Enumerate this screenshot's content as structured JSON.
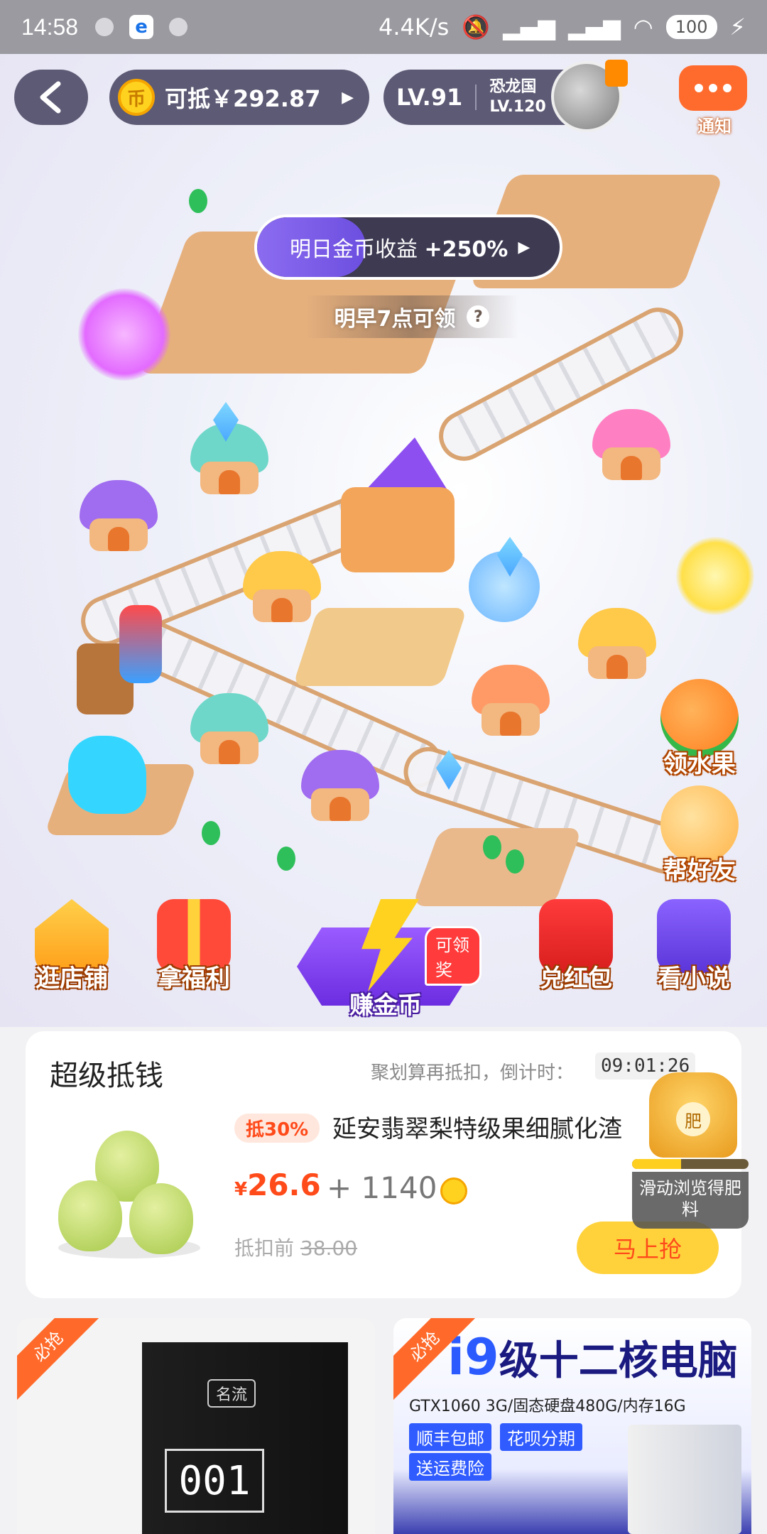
{
  "status_bar": {
    "time": "14:58",
    "network_speed": "4.4K/s",
    "battery": "100"
  },
  "header": {
    "coin_label": "可抵￥292.87",
    "level": "LV.91",
    "next_level_name": "恐龙国",
    "next_level": "LV.120",
    "notice_label": "通知"
  },
  "bonus": {
    "label": "明日金币收益",
    "value": "+250%",
    "progress": 0.36,
    "note": "明早7点可领"
  },
  "side_buttons": [
    {
      "label": "领水果"
    },
    {
      "label": "帮好友"
    }
  ],
  "bottom_nav": {
    "shop": "逛店铺",
    "welfare": "拿福利",
    "earn": "赚金币",
    "earn_badge": "可领奖",
    "redpacket": "兑红包",
    "novel": "看小说"
  },
  "deal_card": {
    "title": "超级抵钱",
    "countdown_label": "聚划算再抵扣，倒计时：",
    "timer": "09:01:26",
    "tag": "抵30%",
    "product_name": "延安翡翠梨特级果细腻化渣",
    "price_symbol": "¥",
    "price": "26.6",
    "plus_coins": "+ 1140",
    "original_label": "抵扣前",
    "original_price": "38.00",
    "buy_label": "马上抢"
  },
  "fertilizer": {
    "icon_text": "肥",
    "progress": 0.42,
    "tip": "滑动浏览得肥料"
  },
  "tiles": [
    {
      "ribbon": "必抢",
      "brand": "名流",
      "number": "001"
    },
    {
      "ribbon": "必抢",
      "headline_num": "i9",
      "headline": "级十二核电脑",
      "spec": "GTX1060 3G/固态硬盘480G/内存16G",
      "chips": [
        "顺丰包邮",
        "花呗分期",
        "送运费险"
      ]
    }
  ],
  "colors": {
    "accent": "#ff4a1a",
    "pill_bg": "#5d5a75",
    "buy_button": "#ffd23c"
  }
}
